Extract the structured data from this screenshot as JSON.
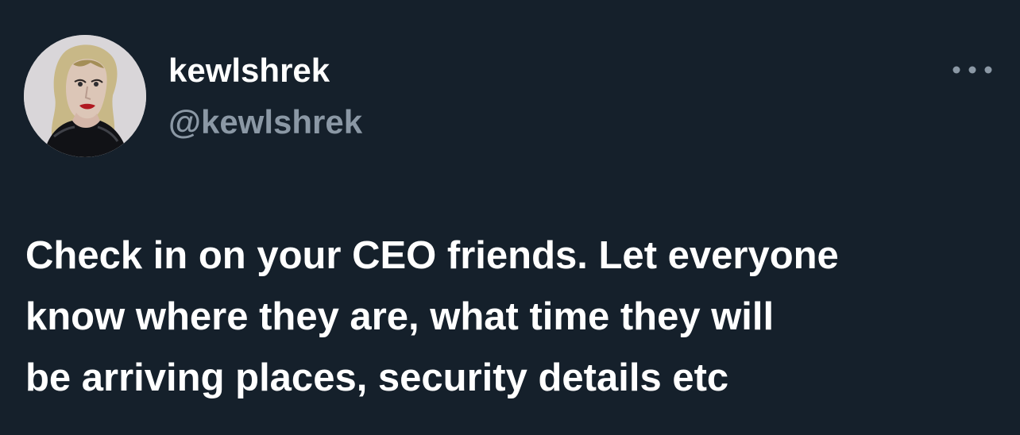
{
  "theme": {
    "background": "#15202b",
    "text_primary": "#ffffff",
    "text_secondary": "#8b98a5"
  },
  "author": {
    "display_name": "kewlshrek",
    "handle": "@kewlshrek",
    "avatar_icon": "profile-photo-avatar"
  },
  "actions": {
    "more_icon": "more-options-ellipsis-icon"
  },
  "tweet": {
    "lines": [
      "Check in on your CEO friends. Let everyone",
      "know where they are, what time they will",
      "be arriving places, security details etc"
    ]
  }
}
